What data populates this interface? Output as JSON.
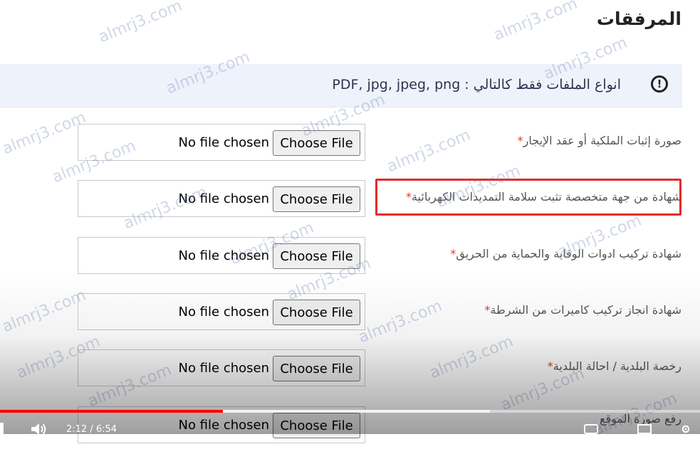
{
  "section": {
    "title": "المرفقات"
  },
  "info": {
    "icon": "exclamation-circle-icon",
    "text": "انواع الملفات فقط كالتالي : PDF, jpg, jpeg, png"
  },
  "file_input": {
    "button_label": "Choose File",
    "status": "No file chosen"
  },
  "required_mark": "*",
  "fields": [
    {
      "label": "صورة إثبات الملكية أو عقد الإيجار"
    },
    {
      "label": "شهادة من جهة متخصصة تثبت سلامة التمديدات الكهربائية"
    },
    {
      "label": "شهادة تركيب ادوات الوقاية والحماية من الحريق"
    },
    {
      "label": "شهادة انجاز تركيب كاميرات من الشرطة"
    },
    {
      "label": "رخصة البلدية / احالة البلدية"
    },
    {
      "label": "رفع صورة الموقع"
    }
  ],
  "watermark": "almrj3.com",
  "player": {
    "time": "2:12 / 6:54",
    "played_fraction": 0.318,
    "buffered_fraction": 0.7,
    "accent": "#ff0000"
  },
  "colors": {
    "highlight": "#e02c2c",
    "info_bg": "#eef2fb"
  }
}
